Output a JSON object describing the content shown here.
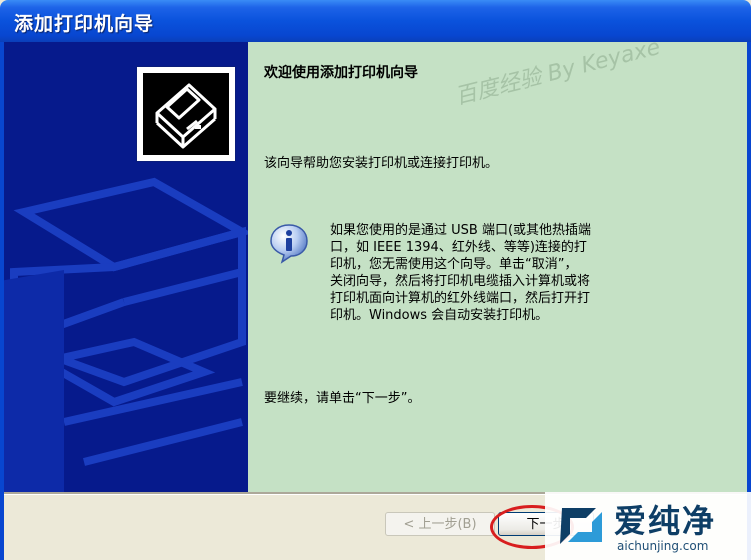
{
  "window": {
    "title": "添加打印机向导"
  },
  "wizard": {
    "heading": "欢迎使用添加打印机向导",
    "watermark": "百度经验 By Keyaxe",
    "intro": "该向导帮助您安装打印机或连接打印机。",
    "info_lines": [
      "如果您使用的是通过 USB 端口(或其他热插端",
      "口，如 IEEE 1394、红外线、等等)连接的打",
      "印机，您无需使用这个向导。单击“取消”，",
      "关闭向导，然后将打印机电缆插入计算机或将",
      "打印机面向计算机的红外线端口，然后打开打",
      "印机。Windows 会自动安装打印机。"
    ],
    "continue": "要继续，请单击“下一步”。"
  },
  "buttons": {
    "back": "< 上一步(B)",
    "next": "下一步"
  },
  "site_logo": {
    "name": "爱纯净",
    "url": "aichunjing.com"
  },
  "colors": {
    "title_bar": "#0a52dc",
    "left_panel": "#061a8c",
    "content_bg": "#c5e1c5",
    "highlight": "#d81e1e"
  },
  "icons": [
    "printer-logo-icon",
    "info-icon",
    "site-logo-icon"
  ]
}
